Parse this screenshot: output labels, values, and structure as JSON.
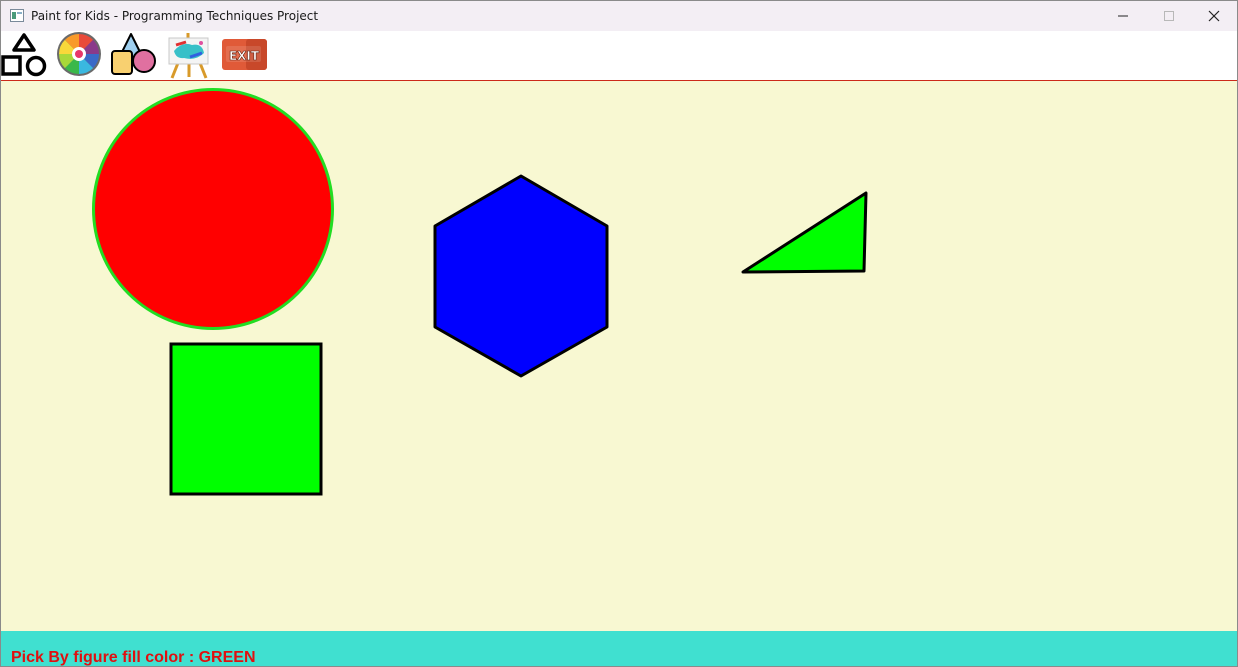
{
  "window": {
    "title": "Paint for Kids - Programming Techniques Project"
  },
  "toolbar": {
    "items": [
      {
        "name": "figures",
        "icon": "shapes-icon"
      },
      {
        "name": "colors",
        "icon": "color-wheel-icon"
      },
      {
        "name": "pick-and-hide",
        "icon": "shape-pick-icon"
      },
      {
        "name": "draw-mode",
        "icon": "easel-icon"
      },
      {
        "name": "exit",
        "icon": "exit-icon",
        "label": "EXIT"
      }
    ]
  },
  "canvas": {
    "background": "#f8f8d2",
    "figures": [
      {
        "type": "circle",
        "fill": "#ff0000",
        "border": "#22dd22"
      },
      {
        "type": "square",
        "fill": "#00ff00",
        "border": "#000000"
      },
      {
        "type": "hexagon",
        "fill": "#0000ff",
        "border": "#000000"
      },
      {
        "type": "triangle",
        "fill": "#00ff00",
        "border": "#000000"
      }
    ]
  },
  "statusbar": {
    "message": "Pick By figure fill color : GREEN",
    "background": "#40e0d0",
    "text_color": "#e01010"
  }
}
